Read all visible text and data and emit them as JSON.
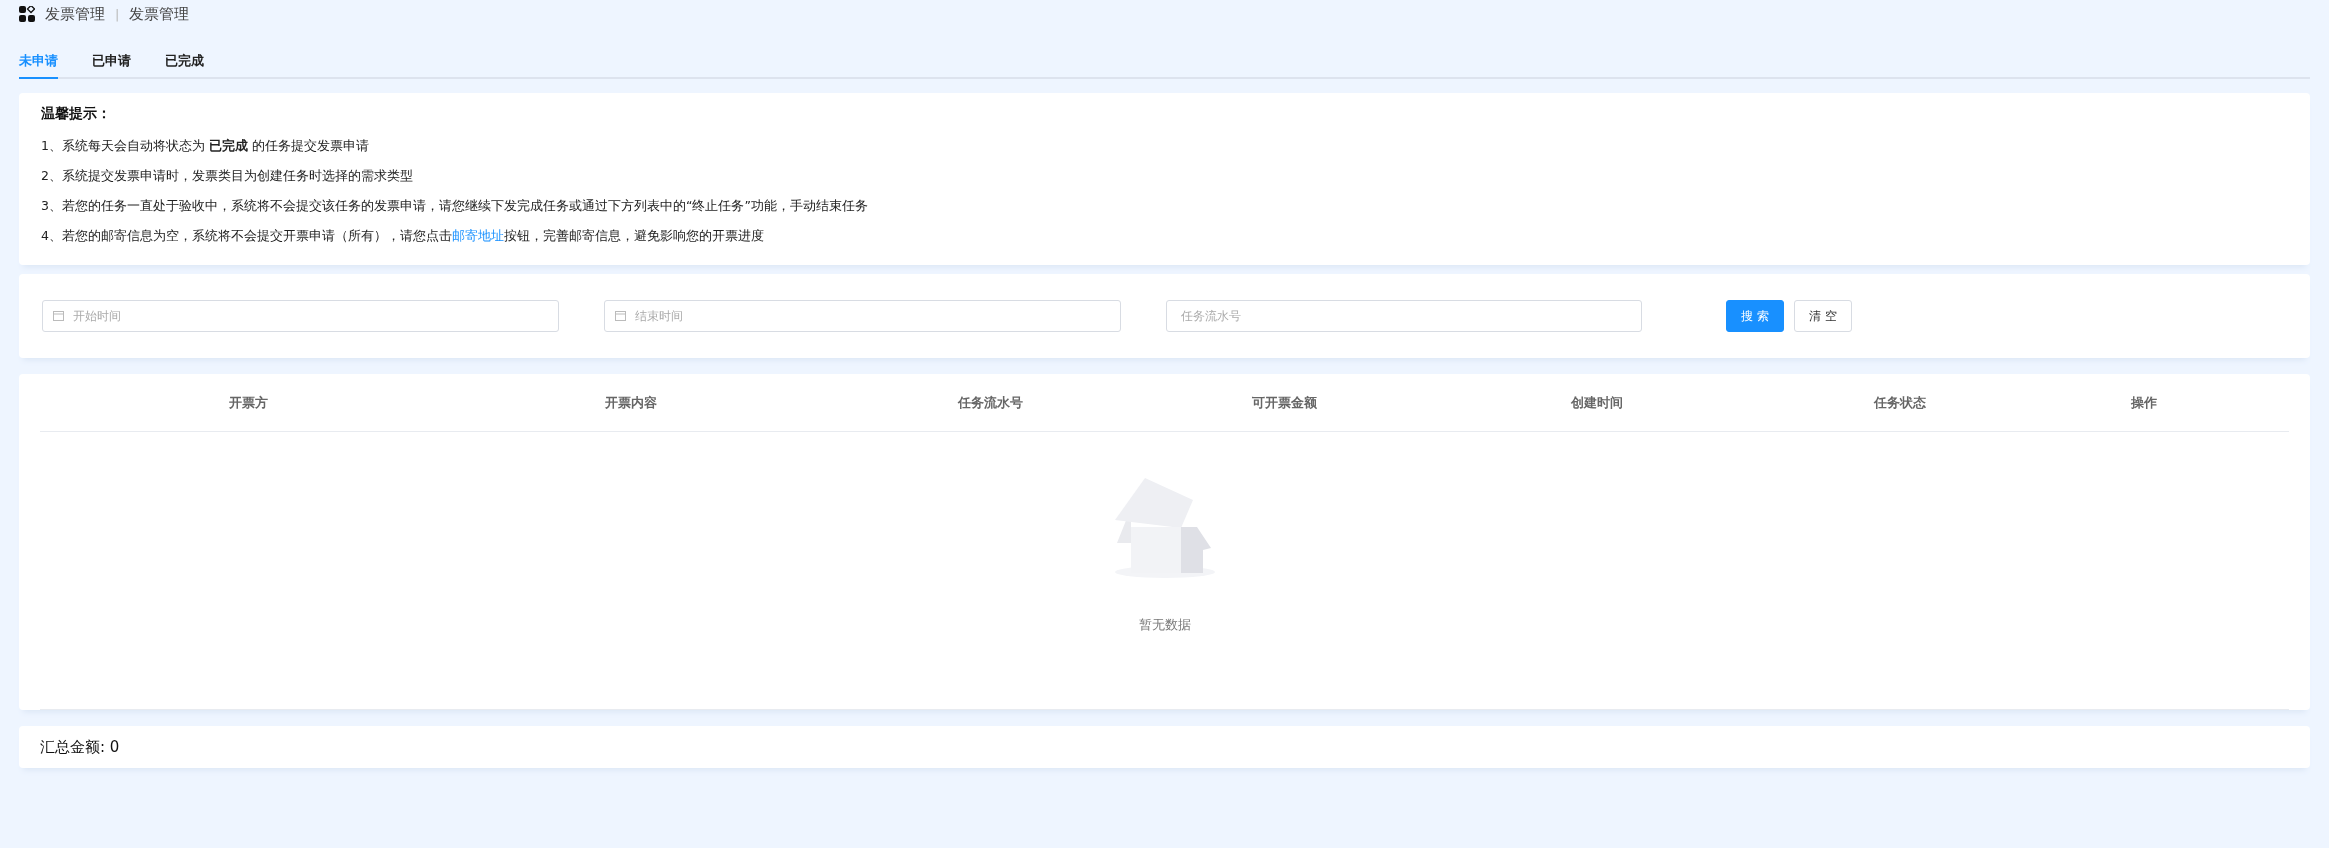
{
  "breadcrumb": [
    "发票管理",
    "发票管理"
  ],
  "breadcrumb_separator": "|",
  "tabs": [
    {
      "label": "未申请",
      "selected": true
    },
    {
      "label": "已申请",
      "selected": false
    },
    {
      "label": "已完成",
      "selected": false
    }
  ],
  "notice": {
    "title": "温馨提示：",
    "lines": [
      {
        "text": "1、系统每天会自动将状态为 **已完成** 的任务提交发票申请"
      },
      {
        "text": "2、系统提交发票申请时，发票类目为创建任务时选择的需求类型"
      },
      {
        "text": "3、若您的任务一直处于验收中，系统将不会提交该任务的发票申请，请您继续下发完成任务或通过下方列表中的“终止任务”功能，手动结束任务"
      },
      {
        "text": "4、若您的邮寄信息为空，系统将不会提交开票申请（所有），请您点击",
        "link": "邮寄地址",
        "after": "按钮，完善邮寄信息，避免影响您的开票进度"
      }
    ]
  },
  "filters": [
    {
      "kind": "date",
      "placeholder": "开始时间"
    },
    {
      "kind": "date",
      "placeholder": "结束时间"
    },
    {
      "kind": "text",
      "placeholder": "任务流水号"
    }
  ],
  "buttons": [
    {
      "label": "搜 索",
      "kind": "primary"
    },
    {
      "label": "清 空",
      "kind": "default"
    }
  ],
  "table": {
    "columns": [
      "开票方",
      "开票内容",
      "任务流水号",
      "可开票金额",
      "创建时间",
      "任务状态",
      "操作"
    ],
    "empty_text": "暂无数据"
  },
  "summary": "汇总金额: 0"
}
